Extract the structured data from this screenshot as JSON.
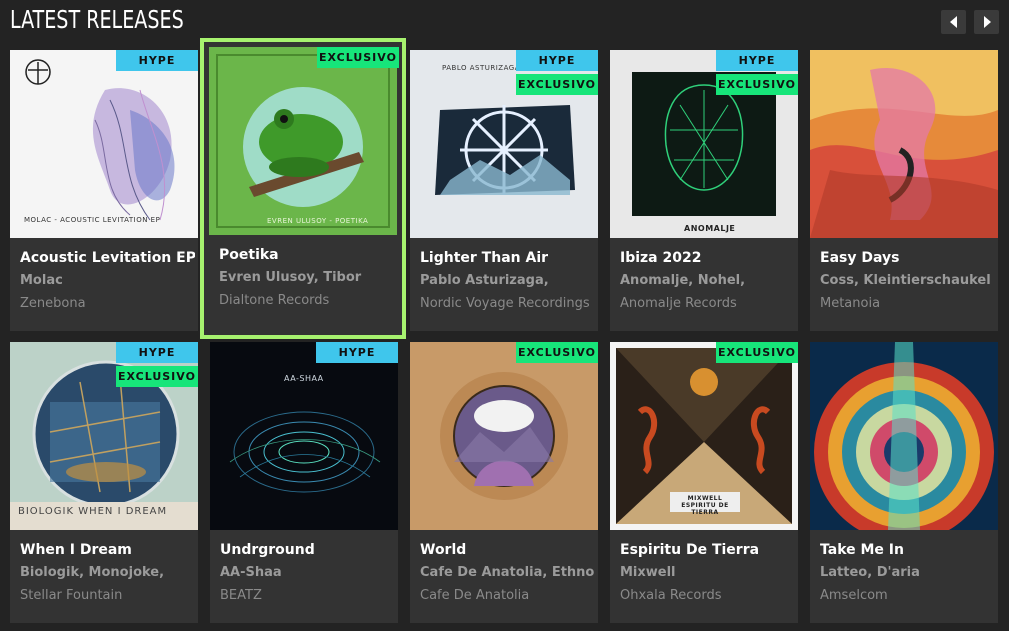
{
  "header": {
    "title": "LATEST RELEASES"
  },
  "nav": {
    "prev_icon": "chevron-left-icon",
    "next_icon": "chevron-right-icon"
  },
  "colors": {
    "hype": "#3fc6ec",
    "exclusivo": "#17e57a",
    "selected_outline": "#a7f26f",
    "card_bg": "#333333",
    "page_bg": "#232323"
  },
  "releases": [
    {
      "title": "Acoustic Levitation EP",
      "artist": "Molac",
      "label": "Zenebona",
      "badges": [
        "HYPE"
      ],
      "cover_text": "MOLAC - ACOUSTIC LEVITATION EP"
    },
    {
      "title": "Poetika",
      "artist": "Evren Ulusoy, Tibor",
      "label": "Dialtone Records",
      "badges": [
        "EXCLUSIVO"
      ],
      "cover_text": "EVREN ULUSOY - POETIKA"
    },
    {
      "title": "Lighter Than Air",
      "artist": "Pablo Asturizaga,",
      "label": "Nordic Voyage Recordings",
      "badges": [
        "HYPE",
        "EXCLUSIVO"
      ],
      "cover_text": "PABLO ASTURIZAGA"
    },
    {
      "title": "Ibiza 2022",
      "artist": "Anomalje, Nohel,",
      "label": "Anomalje Records",
      "badges": [
        "HYPE",
        "EXCLUSIVO"
      ],
      "cover_text": "ANOMALJE"
    },
    {
      "title": "Easy Days",
      "artist": "Coss, Kleintierschaukel",
      "label": "Metanoia",
      "badges": [],
      "cover_text": ""
    },
    {
      "title": "When I Dream",
      "artist": "Biologik, Monojoke,",
      "label": "Stellar Fountain",
      "badges": [
        "HYPE",
        "EXCLUSIVO"
      ],
      "cover_text": "BIOLOGIK  WHEN I DREAM"
    },
    {
      "title": "Undrground",
      "artist": "AA-Shaa",
      "label": "BEATZ",
      "badges": [
        "HYPE"
      ],
      "cover_text": "AA-SHAA"
    },
    {
      "title": "World",
      "artist": "Cafe De Anatolia, Ethno",
      "label": "Cafe De Anatolia",
      "badges": [
        "EXCLUSIVO"
      ],
      "cover_text": ""
    },
    {
      "title": "Espiritu De Tierra",
      "artist": "Mixwell",
      "label": "Ohxala Records",
      "badges": [
        "EXCLUSIVO"
      ],
      "cover_text": "MIXWELL ESPIRITU DE TIERRA"
    },
    {
      "title": "Take Me In",
      "artist": "Latteo, D'aria",
      "label": "Amselcom",
      "badges": [],
      "cover_text": ""
    }
  ]
}
